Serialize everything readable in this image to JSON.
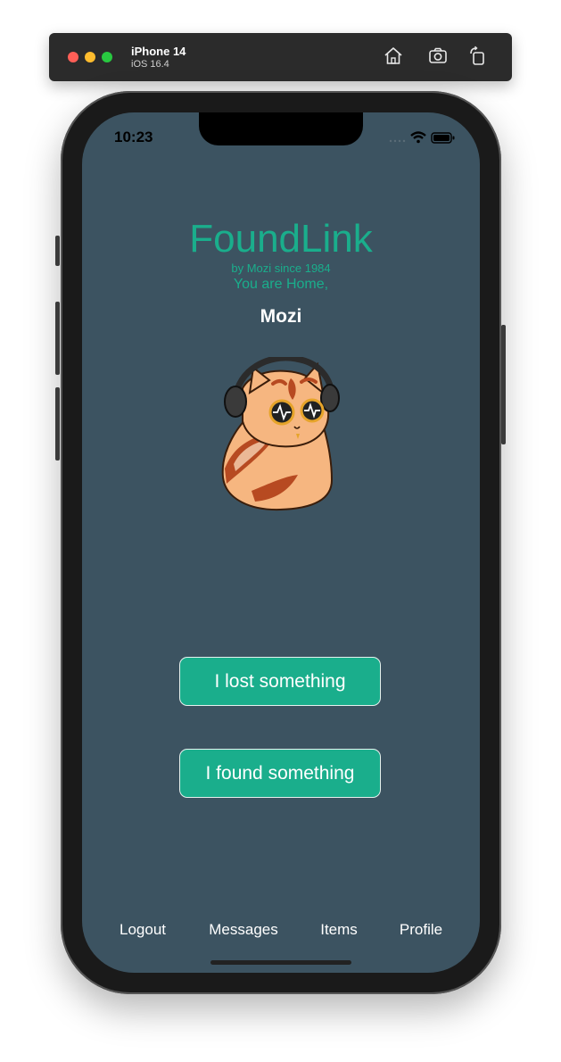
{
  "simulator": {
    "device_name": "iPhone 14",
    "os_version": "iOS 16.4"
  },
  "status_bar": {
    "time": "10:23"
  },
  "app": {
    "title": "FoundLink",
    "byline": "by Mozi since 1984",
    "welcome": "You are Home,",
    "username": "Mozi"
  },
  "actions": {
    "lost_label": "I lost something",
    "found_label": "I found something"
  },
  "tabs": [
    {
      "label": "Logout"
    },
    {
      "label": "Messages"
    },
    {
      "label": "Items"
    },
    {
      "label": "Profile"
    }
  ],
  "colors": {
    "accent": "#1aae8c",
    "screen_bg": "#3c5361",
    "text_light": "#ffffff"
  }
}
